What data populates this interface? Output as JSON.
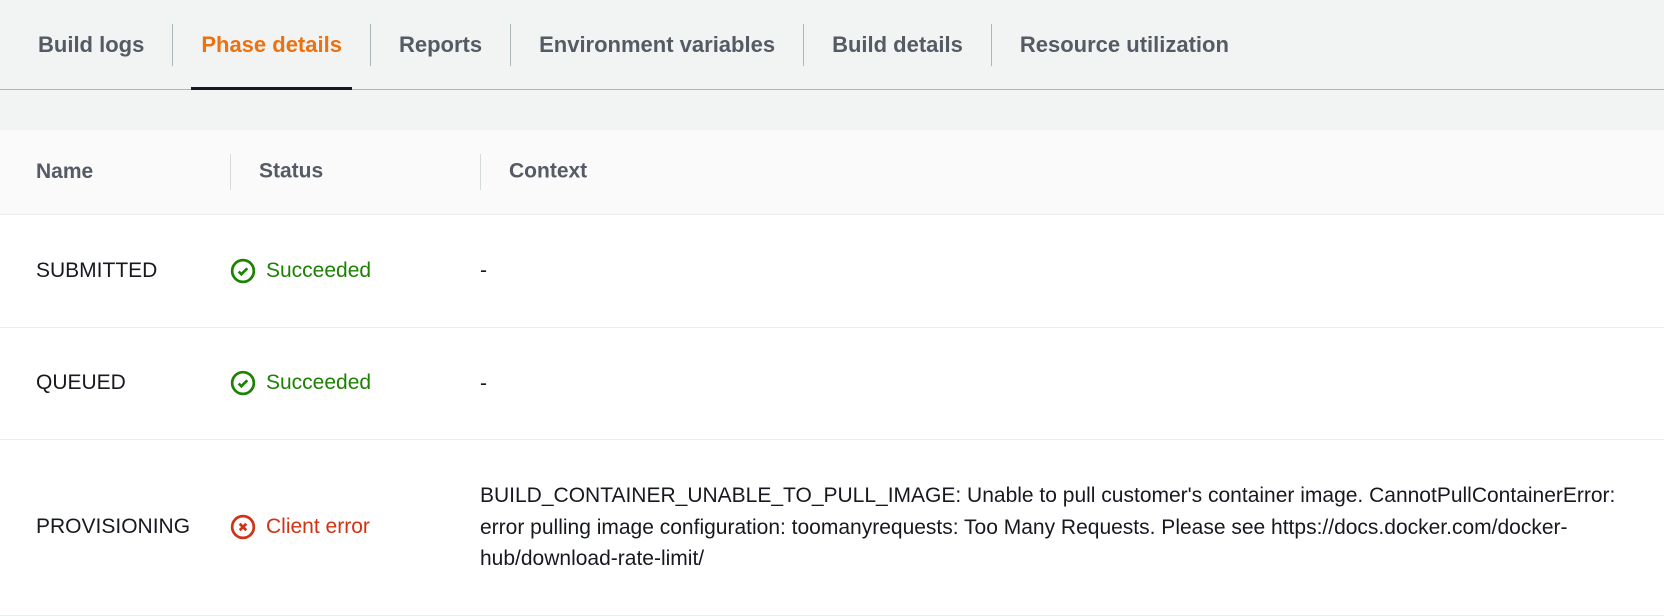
{
  "tabs": [
    {
      "label": "Build logs",
      "active": false
    },
    {
      "label": "Phase details",
      "active": true
    },
    {
      "label": "Reports",
      "active": false
    },
    {
      "label": "Environment variables",
      "active": false
    },
    {
      "label": "Build details",
      "active": false
    },
    {
      "label": "Resource utilization",
      "active": false
    }
  ],
  "table": {
    "headers": {
      "name": "Name",
      "status": "Status",
      "context": "Context"
    },
    "rows": [
      {
        "name": "SUBMITTED",
        "status_type": "success",
        "status_label": "Succeeded",
        "context": "-"
      },
      {
        "name": "QUEUED",
        "status_type": "success",
        "status_label": "Succeeded",
        "context": "-"
      },
      {
        "name": "PROVISIONING",
        "status_type": "error",
        "status_label": "Client error",
        "context": "BUILD_CONTAINER_UNABLE_TO_PULL_IMAGE: Unable to pull customer's container image. CannotPullContainerError: error pulling image configuration: toomanyrequests: Too Many Requests. Please see https://docs.docker.com/docker-hub/download-rate-limit/"
      }
    ]
  }
}
